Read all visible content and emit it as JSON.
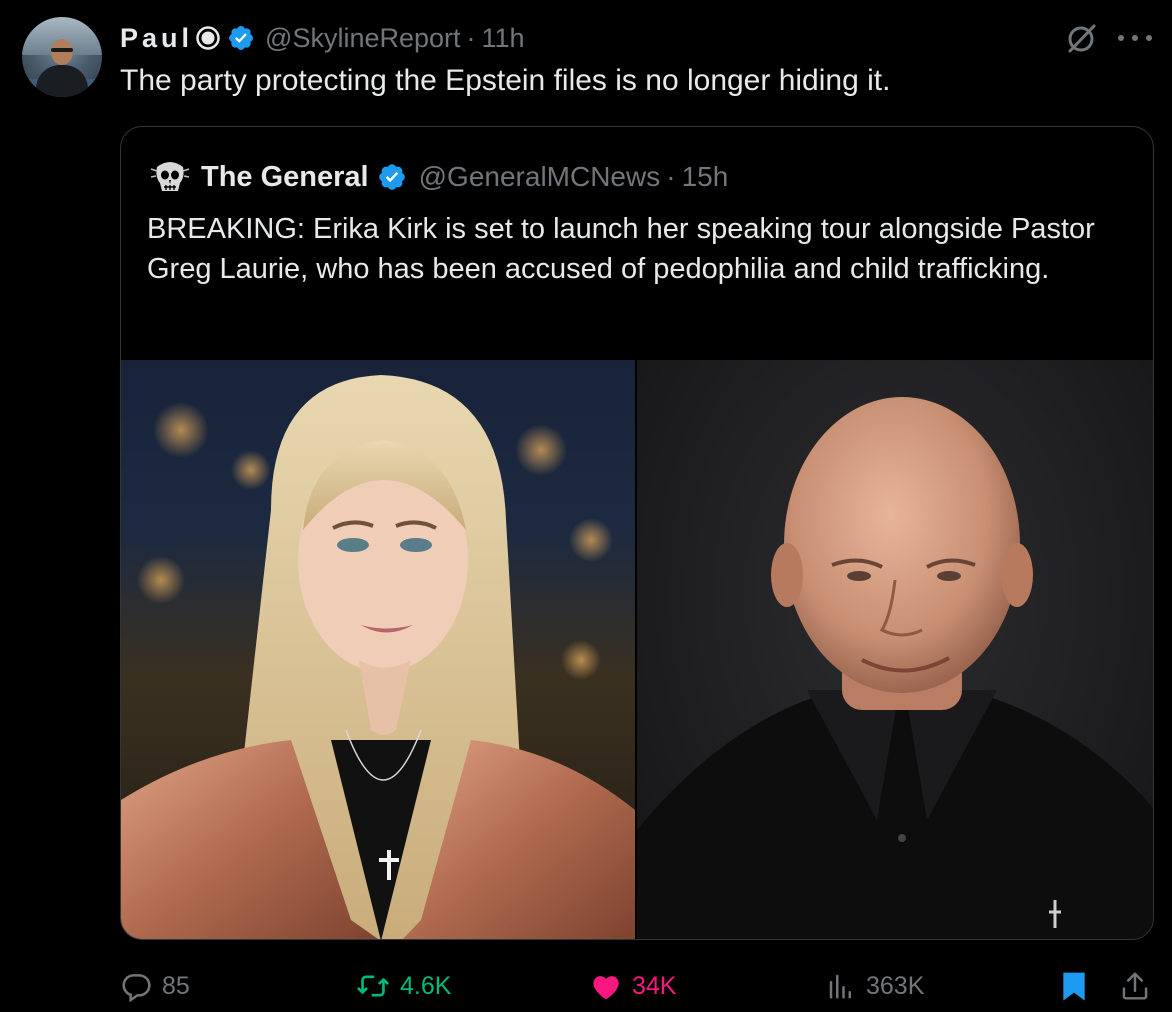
{
  "post": {
    "author": {
      "display_name": "Paul",
      "handle": "@SkylineReport",
      "time": "11h"
    },
    "separator": "·",
    "text": "The party protecting the Epstein files is no longer hiding it."
  },
  "quote": {
    "author": {
      "display_name": "The General",
      "handle": "@GeneralMCNews",
      "time": "15h"
    },
    "separator": "·",
    "text": "BREAKING: Erika Kirk is set to launch her speaking tour alongside Pastor Greg Laurie, who has been accused of pedophilia and child trafficking."
  },
  "actions": {
    "replies": "85",
    "reposts": "4.6K",
    "likes": "34K",
    "views": "363K"
  },
  "colors": {
    "background": "#000000",
    "text_primary": "#e7e9ea",
    "text_secondary": "#71767b",
    "verified_blue": "#1d9bf0",
    "repost_green": "#00ba7c",
    "like_pink": "#f91880",
    "border": "#333639"
  },
  "icons": [
    "circle-badge-icon",
    "verified-badge-icon",
    "grok-icon",
    "more-icon",
    "reply-icon",
    "repost-icon",
    "like-icon",
    "views-icon",
    "bookmark-icon",
    "share-icon"
  ]
}
